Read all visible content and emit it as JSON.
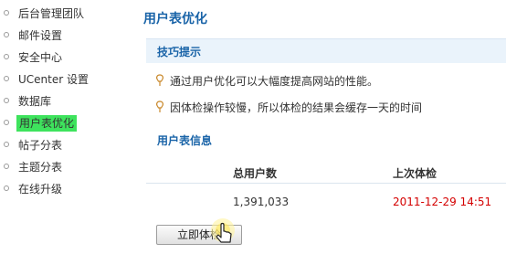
{
  "sidebar": {
    "items": [
      {
        "label": "后台管理团队"
      },
      {
        "label": "邮件设置"
      },
      {
        "label": "安全中心"
      },
      {
        "label": "UCenter 设置"
      },
      {
        "label": "数据库"
      },
      {
        "label": "用户表优化",
        "active": true
      },
      {
        "label": "帖子分表"
      },
      {
        "label": "主题分表"
      },
      {
        "label": "在线升级"
      }
    ]
  },
  "main": {
    "title": "用户表优化",
    "tips": {
      "heading": "技巧提示",
      "items": [
        "通过用户优化可以大幅度提高网站的性能。",
        "因体检操作较慢，所以体检的结果会缓存一天的时间"
      ]
    },
    "info": {
      "heading": "用户表信息",
      "columns": [
        "总用户数",
        "上次体检"
      ],
      "total_users": "1,391,033",
      "last_check": "2011-12-29 14:51"
    },
    "check_button": "立即体检"
  },
  "colors": {
    "accent_blue": "#1a64a8",
    "active_nav": "#3ee35d",
    "last_check_red": "#d40000",
    "section_bg": "#eaf3fb"
  }
}
